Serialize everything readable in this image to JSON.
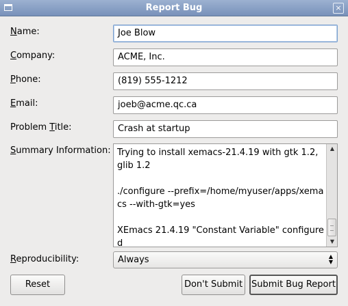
{
  "window": {
    "title": "Report Bug",
    "close_icon": "×"
  },
  "fields": [
    {
      "label_pre": "",
      "label_ul": "N",
      "label_post": "ame:",
      "value": "Joe Blow"
    },
    {
      "label_pre": "",
      "label_ul": "C",
      "label_post": "ompany:",
      "value": "ACME, Inc."
    },
    {
      "label_pre": "",
      "label_ul": "P",
      "label_post": "hone:",
      "value": "(819) 555-1212"
    },
    {
      "label_pre": "",
      "label_ul": "E",
      "label_post": "mail:",
      "value": "joeb@acme.qc.ca"
    },
    {
      "label_pre": "Problem ",
      "label_ul": "T",
      "label_post": "itle:",
      "value": "Crash at startup"
    }
  ],
  "summary": {
    "label_pre": "",
    "label_ul": "S",
    "label_post": "ummary Information:",
    "text": "Trying to install xemacs-21.4.19 with gtk 1.2, glib 1.2\n\n./configure --prefix=/home/myuser/apps/xemacs --with-gtk=yes\n\nXEmacs 21.4.19 \"Constant Variable\" configured"
  },
  "reproducibility": {
    "label_pre": "",
    "label_ul": "R",
    "label_post": "eproducibility:",
    "selected": "Always"
  },
  "buttons": {
    "reset": "Reset",
    "dont_submit": "Don't Submit",
    "submit": "Submit Bug Report"
  },
  "scrollbar": {
    "thumb_start": 0.78,
    "thumb_size": 0.22
  }
}
